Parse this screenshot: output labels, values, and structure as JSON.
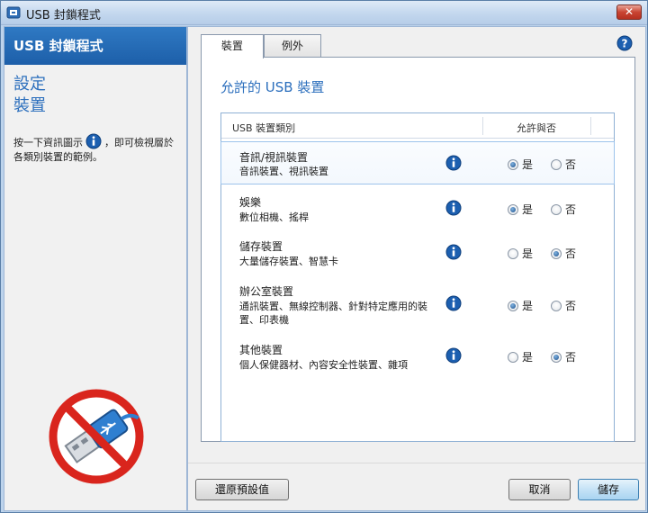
{
  "window": {
    "title": "USB 封鎖程式",
    "close_label": "✕"
  },
  "sidebar": {
    "header": "USB 封鎖程式",
    "heading_line1": "設定",
    "heading_line2": "裝置",
    "desc_before": "按一下資訊圖示",
    "desc_after": "，即可檢視層於各類別裝置的範例。"
  },
  "tabs": [
    {
      "label": "裝置",
      "active": true
    },
    {
      "label": "例外",
      "active": false
    }
  ],
  "main": {
    "section_title": "允許的 USB 裝置",
    "column_category": "USB 裝置類別",
    "column_allowed": "允許與否",
    "yes_label": "是",
    "no_label": "否",
    "rows": [
      {
        "name": "音訊/視訊裝置",
        "desc": "音訊裝置、視訊裝置",
        "allowed": "yes"
      },
      {
        "name": "娛樂",
        "desc": "數位相機、搖桿",
        "allowed": "yes"
      },
      {
        "name": "儲存裝置",
        "desc": "大量儲存裝置、智慧卡",
        "allowed": "no"
      },
      {
        "name": "辦公室裝置",
        "desc": "通訊裝置、無線控制器、針對特定應用的裝置、印表機",
        "allowed": "yes"
      },
      {
        "name": "其他裝置",
        "desc": "個人保健器材、內容安全性裝置、雜項",
        "allowed": "no"
      }
    ]
  },
  "footer": {
    "restore_label": "還原預設值",
    "cancel_label": "取消",
    "save_label": "儲存"
  },
  "icons": {
    "info": "info-icon",
    "help": "help-icon",
    "usb_blocked": "usb-blocked-icon",
    "app": "app-icon"
  },
  "colors": {
    "accent": "#2c6fbd",
    "header": "#1d5fa9",
    "info_blue": "#1c5fb0",
    "prohibit_red": "#d9251d"
  }
}
